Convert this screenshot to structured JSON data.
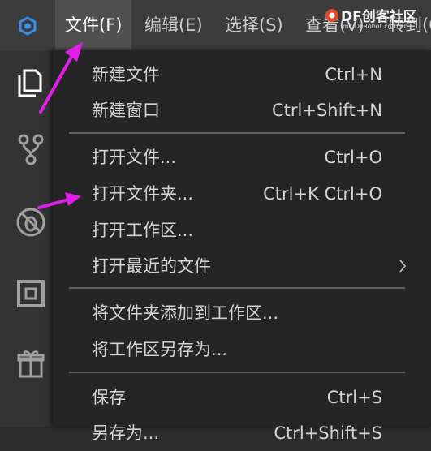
{
  "menubar": {
    "items": [
      {
        "label": "文件(F)",
        "active": true
      },
      {
        "label": "编辑(E)"
      },
      {
        "label": "选择(S)"
      },
      {
        "label": "查看(V)"
      },
      {
        "label": "转到(G)"
      }
    ]
  },
  "watermark": {
    "title": "DF创客社区",
    "url": "mc.DFRobot.com.cn"
  },
  "activitybar": {
    "icons": [
      "explorer-icon",
      "source-control-icon",
      "debug-icon",
      "extensions-icon",
      "gift-icon"
    ]
  },
  "file_menu": {
    "groups": [
      [
        {
          "label": "新建文件",
          "shortcut": "Ctrl+N"
        },
        {
          "label": "新建窗口",
          "shortcut": "Ctrl+Shift+N"
        }
      ],
      [
        {
          "label": "打开文件...",
          "shortcut": "Ctrl+O"
        },
        {
          "label": "打开文件夹...",
          "shortcut": "Ctrl+K Ctrl+O"
        },
        {
          "label": "打开工作区...",
          "shortcut": ""
        },
        {
          "label": "打开最近的文件",
          "shortcut": "",
          "submenu": true
        }
      ],
      [
        {
          "label": "将文件夹添加到工作区...",
          "shortcut": ""
        },
        {
          "label": "将工作区另存为...",
          "shortcut": ""
        }
      ],
      [
        {
          "label": "保存",
          "shortcut": "Ctrl+S"
        },
        {
          "label": "另存为...",
          "shortcut": "Ctrl+Shift+S"
        }
      ]
    ]
  },
  "colors": {
    "accent_arrow": "#e020e8",
    "logo": "#3b8eea",
    "menu_bg": "#252526"
  }
}
